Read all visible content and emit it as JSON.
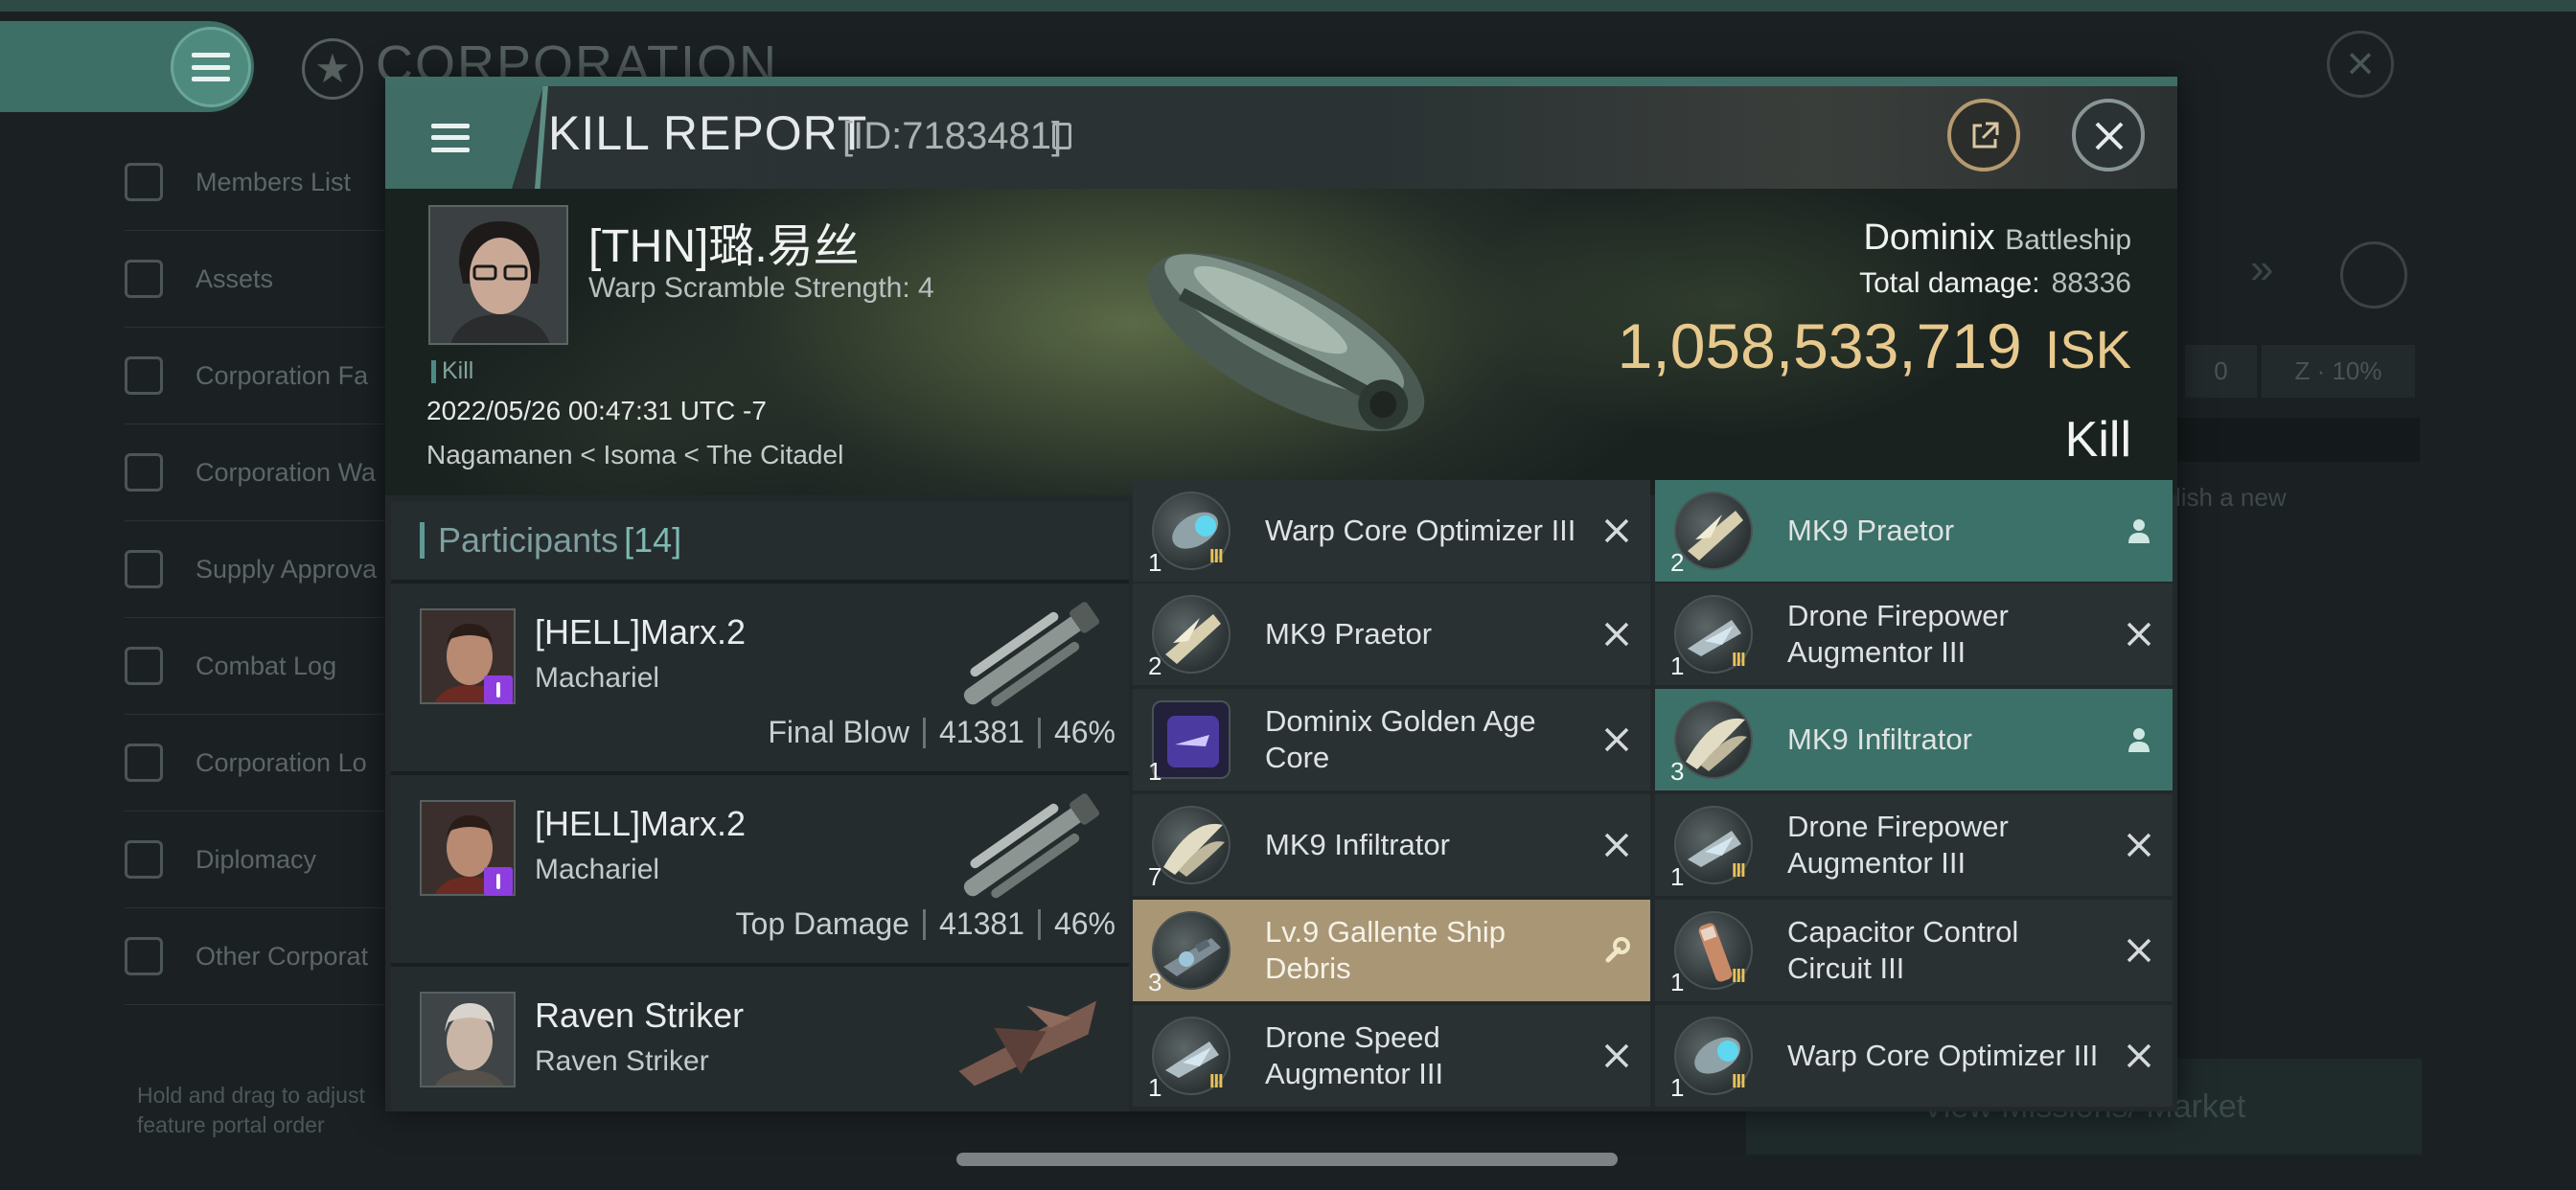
{
  "background": {
    "corp_title": "CORPORATION",
    "sidebar": [
      {
        "label": "Members List"
      },
      {
        "label": "Assets"
      },
      {
        "label": "Corporation Fa"
      },
      {
        "label": "Corporation Wa"
      },
      {
        "label": "Supply Approva"
      },
      {
        "label": "Combat Log"
      },
      {
        "label": "Corporation Lo"
      },
      {
        "label": "Diplomacy"
      },
      {
        "label": "Other Corporat"
      }
    ],
    "hint": "Hold and drag to adjust\nfeature portal order",
    "field_value": "0",
    "field_pct": "10%",
    "publish_text": "lish a new",
    "bottom_button": "View Missions/ Market"
  },
  "modal": {
    "title": "KILL REPORT",
    "id_label": "[ID:7183481]"
  },
  "victim": {
    "pilot_name": "[THN]璐.易丝",
    "warp_scramble": "Warp Scramble Strength: 4",
    "kill_tag": "Kill",
    "datetime": "2022/05/26 00:47:31 UTC -7",
    "location": "Nagamanen < Isoma < The Citadel",
    "ship_name": "Dominix",
    "ship_class": "Battleship",
    "total_damage_label": "Total damage:",
    "total_damage": "88336",
    "isk_value": "1,058,533,719",
    "isk_unit": "ISK",
    "result": "Kill"
  },
  "participants": {
    "title": "Participants",
    "count": "[14]",
    "rows": [
      {
        "name": "[HELL]Marx.2",
        "ship": "Machariel",
        "label": "Final Blow",
        "damage": "41381",
        "pct": "46%"
      },
      {
        "name": "[HELL]Marx.2",
        "ship": "Machariel",
        "label": "Top Damage",
        "damage": "41381",
        "pct": "46%"
      },
      {
        "name": "Raven Striker",
        "ship": "Raven Striker",
        "label": "",
        "damage": "",
        "pct": ""
      }
    ]
  },
  "items_left": [
    {
      "name": "Warp Core Optimizer III",
      "qty": "1",
      "tier": "III",
      "state": "destroyed"
    },
    {
      "name": "MK9  Praetor",
      "qty": "2",
      "tier": "",
      "state": "destroyed"
    },
    {
      "name": "Dominix Golden Age Core",
      "qty": "1",
      "tier": "",
      "state": "destroyed"
    },
    {
      "name": "MK9  Infiltrator",
      "qty": "7",
      "tier": "",
      "state": "destroyed"
    },
    {
      "name": "Lv.9 Gallente Ship Debris",
      "qty": "3",
      "tier": "",
      "state": "dropped"
    },
    {
      "name": "Drone Speed Augmentor III",
      "qty": "1",
      "tier": "III",
      "state": "destroyed"
    }
  ],
  "items_right": [
    {
      "name": "MK9  Praetor",
      "qty": "2",
      "tier": "",
      "state": "deployed"
    },
    {
      "name": "Drone Firepower Augmentor III",
      "qty": "1",
      "tier": "III",
      "state": "destroyed"
    },
    {
      "name": "MK9  Infiltrator",
      "qty": "3",
      "tier": "",
      "state": "deployed"
    },
    {
      "name": "Drone Firepower Augmentor III",
      "qty": "1",
      "tier": "III",
      "state": "destroyed"
    },
    {
      "name": "Capacitor Control Circuit III",
      "qty": "1",
      "tier": "III",
      "state": "destroyed"
    },
    {
      "name": "Warp Core Optimizer III",
      "qty": "1",
      "tier": "III",
      "state": "destroyed"
    }
  ],
  "colors": {
    "accent": "#3f6c64",
    "isk": "#e8c98d",
    "dropped": "#a89675",
    "deployed": "#3b7168",
    "implant_badge": "#8e3ee0"
  }
}
